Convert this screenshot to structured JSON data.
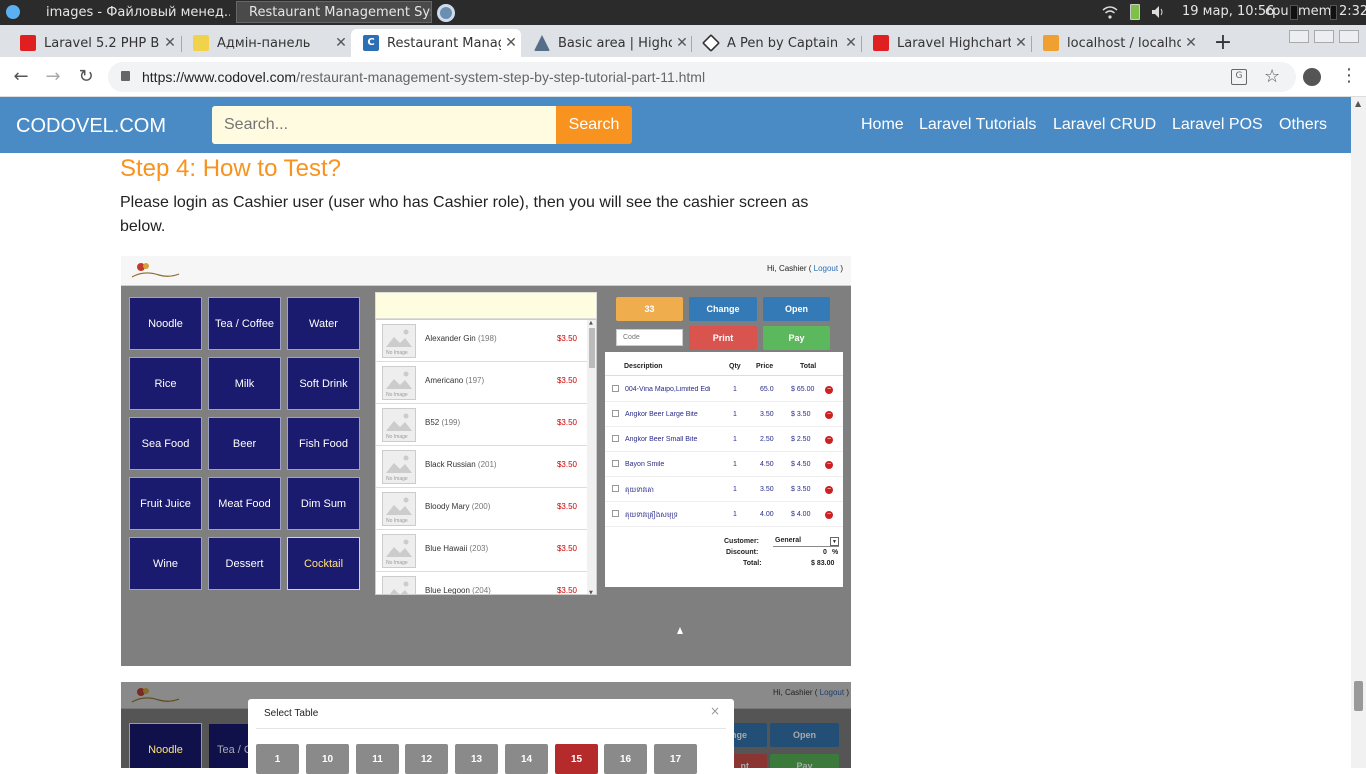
{
  "taskbar": {
    "tasks": [
      {
        "label": "images - Файловый менед..."
      },
      {
        "label": "Restaurant Management Sys..."
      }
    ],
    "clock": "19 мар, 10:56",
    "cpu": "cpu",
    "mem": "mem",
    "time": "2:32"
  },
  "tabs": [
    {
      "title": "Laravel 5.2 PHP Bu",
      "icon": "youtube-icon"
    },
    {
      "title": "Адмін-панель",
      "icon": "adminer-icon"
    },
    {
      "title": "Restaurant Manag",
      "icon": "codovel-icon"
    },
    {
      "title": "Basic area | Highc",
      "icon": "highcharts-icon"
    },
    {
      "title": "A Pen by Captain A",
      "icon": "codepen-icon"
    },
    {
      "title": "Laravel Highchart",
      "icon": "youtube-icon"
    },
    {
      "title": "localhost / localhos",
      "icon": "phpmyadmin-icon"
    }
  ],
  "address": {
    "url_host": "https://www.codovel.com",
    "url_path": "/restaurant-management-system-step-by-step-tutorial-part-11.html"
  },
  "site": {
    "brand": "CODOVEL.COM",
    "search_placeholder": "Search...",
    "search_button": "Search",
    "nav": [
      "Home",
      "Laravel Tutorials",
      "Laravel CRUD",
      "Laravel POS",
      "Others"
    ]
  },
  "article": {
    "heading": "Step 4: How to Test?",
    "para_line1": "Please login as Cashier user (user who has Cashier role), then you will see the cashier screen as",
    "para_line2": "below."
  },
  "pos": {
    "greeting": "Hi, Cashier (",
    "logout": "Logout",
    "greeting_end": ")",
    "categories": [
      "Noodle",
      "Tea / Coffee",
      "Water",
      "Rice",
      "Milk",
      "Soft Drink",
      "Sea Food",
      "Beer",
      "Fish Food",
      "Fruit Juice",
      "Meat Food",
      "Dim Sum",
      "Wine",
      "Dessert",
      "Cocktail"
    ],
    "selected_category": "Cocktail",
    "no_image": "No Image",
    "products": [
      {
        "name": "Alexander Gin",
        "id": "(198)",
        "price": "$3.50"
      },
      {
        "name": "Americano",
        "id": "(197)",
        "price": "$3.50"
      },
      {
        "name": "B52",
        "id": "(199)",
        "price": "$3.50"
      },
      {
        "name": "Black Russian",
        "id": "(201)",
        "price": "$3.50"
      },
      {
        "name": "Bloody Mary",
        "id": "(200)",
        "price": "$3.50"
      },
      {
        "name": "Blue Hawaii",
        "id": "(203)",
        "price": "$3.50"
      },
      {
        "name": "Blue Legoon",
        "id": "(204)",
        "price": "$3.50"
      }
    ],
    "table_number": "33",
    "change": "Change",
    "open": "Open",
    "code_placeholder": "Code",
    "print": "Print",
    "pay": "Pay",
    "order_headers": {
      "desc": "Description",
      "qty": "Qty",
      "price": "Price",
      "total": "Total"
    },
    "order_rows": [
      {
        "desc": "004-Vina Maipo,Limited Edi",
        "qty": "1",
        "price": "65.0",
        "total": "$ 65.00"
      },
      {
        "desc": "Angkor Beer Large Bite",
        "qty": "1",
        "price": "3.50",
        "total": "$ 3.50"
      },
      {
        "desc": "Angkor Beer Small Bite",
        "qty": "1",
        "price": "2.50",
        "total": "$ 2.50"
      },
      {
        "desc": "Bayon Smile",
        "qty": "1",
        "price": "4.50",
        "total": "$ 4.50"
      },
      {
        "desc": "គុយទាវគោ",
        "qty": "1",
        "price": "3.50",
        "total": "$ 3.50"
      },
      {
        "desc": "គុយទាវគ្រឿងសមុទ្រ",
        "qty": "1",
        "price": "4.00",
        "total": "$ 4.00"
      }
    ],
    "customer_label": "Customer:",
    "customer_value": "General",
    "discount_label": "Discount:",
    "discount_value": "0",
    "discount_unit": "%",
    "total_label": "Total:",
    "total_value": "$ 83.00"
  },
  "pos2": {
    "greeting": "Hi, Cashier (",
    "logout": "Logout",
    "greeting_end": ")",
    "cat1": "Noodle",
    "cat2": "Tea / C",
    "dialog_title": "Select Table",
    "dialog_close": "×",
    "tables": [
      "1",
      "10",
      "11",
      "12",
      "13",
      "14",
      "15",
      "16",
      "17"
    ],
    "selected_table": "15",
    "change_partial": "ange",
    "open": "Open",
    "print_partial": "nt",
    "pay": "Pay"
  },
  "colors": {
    "nav_blue": "#4a8bc6",
    "search_orange": "#f7931e",
    "heading_orange": "#f7931e",
    "category_navy": "#1a1a6e",
    "btn_orange": "#f0ad4e",
    "btn_blue": "#337ab7",
    "btn_red": "#d9534f",
    "btn_green": "#5cb85c",
    "table_selected": "#b52a2a"
  }
}
